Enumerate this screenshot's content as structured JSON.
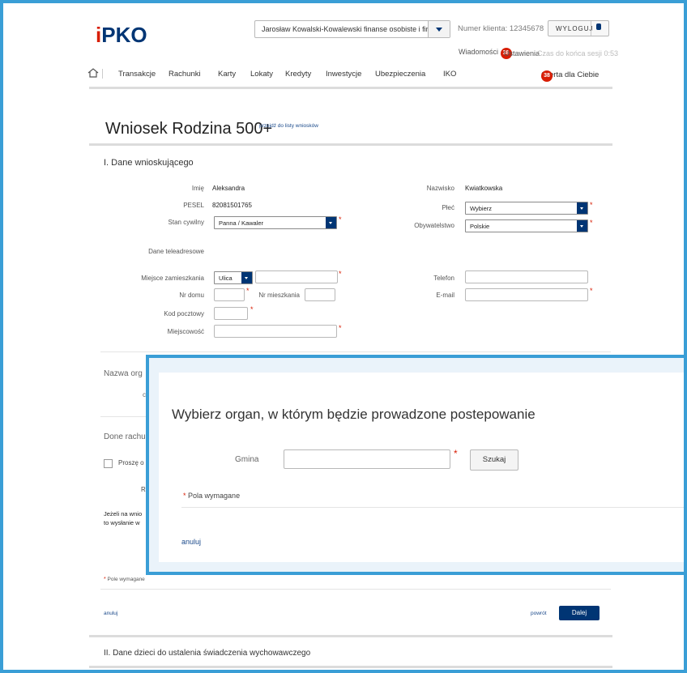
{
  "header": {
    "logo_mark": "i",
    "logo_text": "PKO",
    "client_select": "Jarosław Kowalski-Kowalewski finanse osobiste i firmowe",
    "client_number": "Numer klienta: 12345678",
    "logout_label": "WYLOGUJ",
    "messages_label": "Wiadomości",
    "messages_count": "38",
    "settings_label": "Ustawienia",
    "session_text": "Czas do końca sesji 0:53"
  },
  "nav": {
    "items": [
      "Transakcje",
      "Rachunki",
      "Karty",
      "Lokaty",
      "Kredyty",
      "Inwestycje",
      "Ubezpieczenia",
      "IKO"
    ],
    "offer_label": "Oferta dla Ciebie",
    "offer_count": "38"
  },
  "page": {
    "title": "Wniosek Rodzina 500+",
    "back_link": "przejdź do listy wniosków"
  },
  "section1": {
    "title": "I. Dane wnioskującego",
    "imie_label": "Imię",
    "imie_value": "Aleksandra",
    "pesel_label": "PESEL",
    "pesel_value": "82081501765",
    "stan_label": "Stan cywilny",
    "stan_value": "Panna / Kawaler",
    "nazwisko_label": "Nazwisko",
    "nazwisko_value": "Kwiatkowska",
    "plec_label": "Płeć",
    "plec_value": "Wybierz",
    "obyw_label": "Obywatelstwo",
    "obyw_value": "Polskie",
    "contact_label": "Dane teleadresowe",
    "miejsce_label": "Miejsce zamieszkania",
    "ulica_value": "Ulica",
    "nr_domu_label": "Nr domu",
    "nr_mieszkania_label": "Nr mieszkania",
    "kod_label": "Kod pocztowy",
    "miejscowosc_label": "Miejscowość",
    "telefon_label": "Telefon",
    "email_label": "E-mail"
  },
  "hidden_sections": {
    "organ_partial": "Nazwa org",
    "organ_partial2": "c",
    "rachunek_partial": "Done rachu",
    "prosze_partial": "Proszę o",
    "r_partial": "R",
    "note_line1": "Jeżeli na wnio",
    "note_line2": "to wysłanie w"
  },
  "footer": {
    "required_note": "Pole wymagane",
    "cancel_label": "anuluj",
    "back_label": "powrót",
    "next_label": "Dalej",
    "section2_title": "II. Dane dzieci do ustalenia świadczenia wychowawczego"
  },
  "modal": {
    "title": "Wybierz organ, w którym będzie prowadzone postepowanie",
    "gmina_label": "Gmina",
    "search_label": "Szukaj",
    "required_note": "Pola wymagane",
    "cancel_label": "anuluj"
  },
  "colors": {
    "brand_navy": "#003574",
    "accent_red": "#d81e05",
    "frame_blue": "#3a9ed6"
  }
}
